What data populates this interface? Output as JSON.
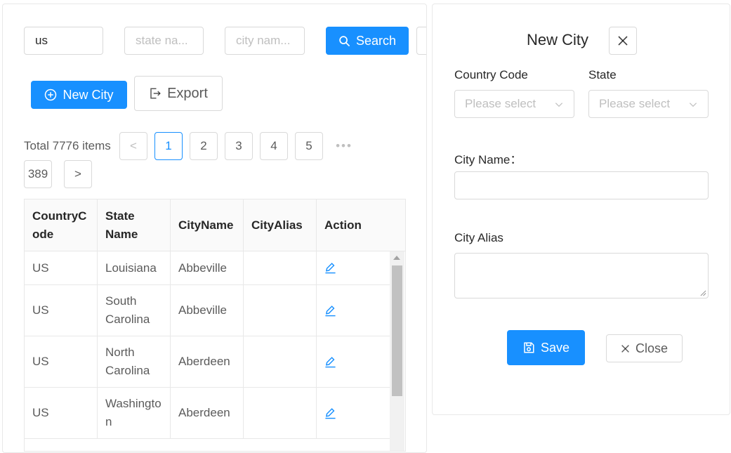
{
  "filters": {
    "country_value": "us",
    "state_placeholder": "state na...",
    "city_placeholder": "city nam...",
    "search_label": "Search"
  },
  "toolbar": {
    "new_city_label": "New City",
    "export_label": "Export"
  },
  "pagination": {
    "total_text": "Total 7776 items",
    "prev": "<",
    "next": ">",
    "pages": [
      "1",
      "2",
      "3",
      "4",
      "5"
    ],
    "ellipsis": "•••",
    "last_page": "389",
    "current": "1"
  },
  "table": {
    "columns": [
      "CountryCode",
      "State Name",
      "CityName",
      "CityAlias",
      "Action"
    ],
    "rows": [
      {
        "country": "US",
        "state": "Louisiana",
        "city": "Abbeville",
        "alias": ""
      },
      {
        "country": "US",
        "state": "South Carolina",
        "city": "Abbeville",
        "alias": ""
      },
      {
        "country": "US",
        "state": "North Carolina",
        "city": "Aberdeen",
        "alias": ""
      },
      {
        "country": "US",
        "state": "Washington",
        "city": "Aberdeen",
        "alias": ""
      }
    ]
  },
  "modal": {
    "title": "New City",
    "country_code_label": "Country Code",
    "state_label": "State",
    "country_placeholder": "Please select",
    "state_placeholder": "Please select",
    "city_name_label": "City Name：",
    "city_alias_label": "City Alias",
    "save_label": "Save",
    "close_label": "Close"
  },
  "colors": {
    "primary": "#1890ff",
    "border": "#d9d9d9"
  }
}
